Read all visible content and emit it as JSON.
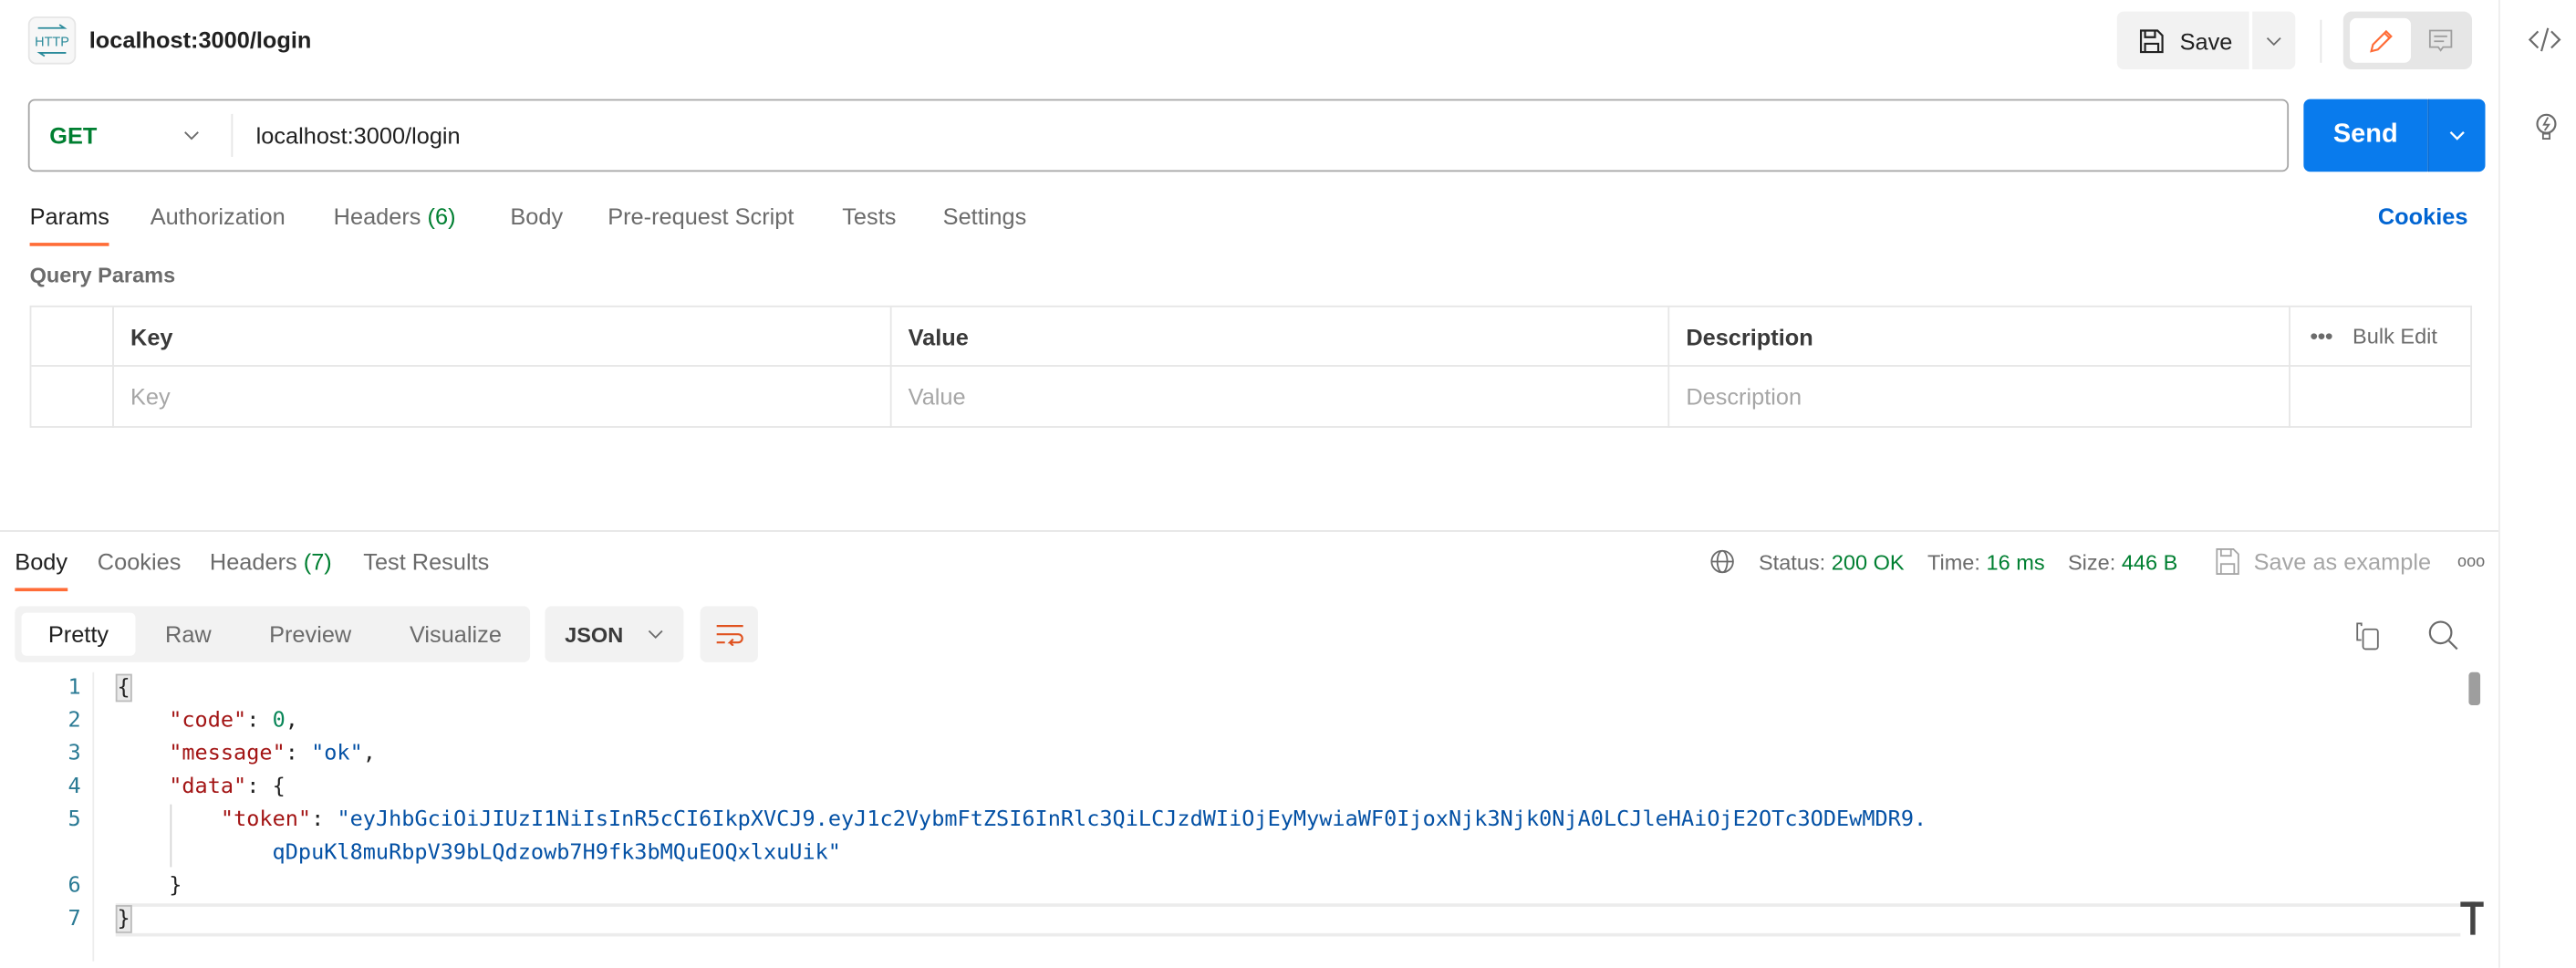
{
  "header": {
    "title": "localhost:3000/login",
    "http_icon": "http-icon",
    "save_label": "Save"
  },
  "request": {
    "method": "GET",
    "url": "localhost:3000/login",
    "send_label": "Send",
    "method_color": "#007F31",
    "send_color": "#097BED"
  },
  "request_tabs": [
    {
      "label": "Params",
      "active": true
    },
    {
      "label": "Authorization"
    },
    {
      "label": "Headers",
      "count": "(6)"
    },
    {
      "label": "Body"
    },
    {
      "label": "Pre-request Script"
    },
    {
      "label": "Tests"
    },
    {
      "label": "Settings"
    }
  ],
  "cookies_link": "Cookies",
  "query_params": {
    "title": "Query Params",
    "columns": [
      "Key",
      "Value",
      "Description"
    ],
    "bulk_edit": "Bulk Edit",
    "placeholders": [
      "Key",
      "Value",
      "Description"
    ]
  },
  "response_tabs": [
    {
      "label": "Body",
      "active": true
    },
    {
      "label": "Cookies"
    },
    {
      "label": "Headers",
      "count": "(7)"
    },
    {
      "label": "Test Results"
    }
  ],
  "status": {
    "status_label": "Status:",
    "status_value": "200 OK",
    "time_label": "Time:",
    "time_value": "16 ms",
    "size_label": "Size:",
    "size_value": "446 B",
    "save_example": "Save as example"
  },
  "view_modes": [
    "Pretty",
    "Raw",
    "Preview",
    "Visualize"
  ],
  "format": "JSON",
  "code": {
    "line_numbers": [
      "1",
      "2",
      "3",
      "4",
      "5",
      "",
      "6",
      "7"
    ],
    "k_code": "\"code\"",
    "v_code": "0",
    "k_message": "\"message\"",
    "v_message": "\"ok\"",
    "k_data": "\"data\"",
    "k_token": "\"token\"",
    "v_token_1": "\"eyJhbGciOiJIUzI1NiIsInR5cCI6IkpXVCJ9.eyJ1c2VybmFtZSI6InRlc3QiLCJzdWIiOjEyMywiaWF0IjoxNjk3Njk0NjA0LCJleHAiOjE2OTc3ODEwMDR9.",
    "v_token_2": "qDpuKl8muRbpV39bLQdzowb7H9fk3bMQuEOQxlxuUik\""
  }
}
